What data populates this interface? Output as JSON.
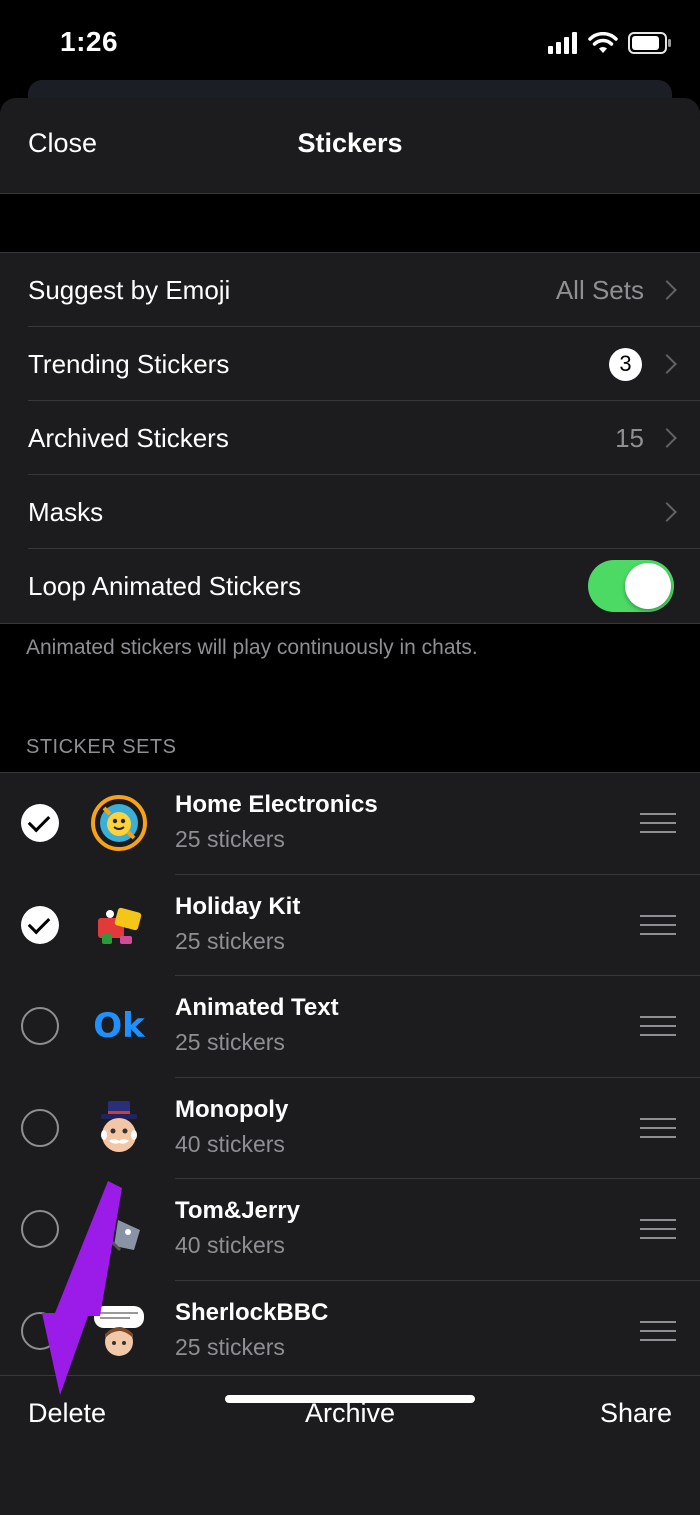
{
  "status_bar": {
    "time": "1:26"
  },
  "navbar": {
    "close_label": "Close",
    "title": "Stickers"
  },
  "settings": {
    "suggest_by_emoji": {
      "label": "Suggest by Emoji",
      "value": "All Sets"
    },
    "trending": {
      "label": "Trending Stickers",
      "badge": "3"
    },
    "archived": {
      "label": "Archived Stickers",
      "value": "15"
    },
    "masks": {
      "label": "Masks"
    },
    "loop": {
      "label": "Loop Animated Stickers",
      "on": true
    },
    "footer": "Animated stickers will play continuously in chats."
  },
  "sticker_sets_header": "STICKER SETS",
  "sticker_sets": [
    {
      "name": "Home Electronics",
      "count": "25 stickers",
      "selected": true
    },
    {
      "name": "Holiday Kit",
      "count": "25 stickers",
      "selected": true
    },
    {
      "name": "Animated Text",
      "count": "25 stickers",
      "selected": false,
      "thumb_text": "Ok"
    },
    {
      "name": "Monopoly",
      "count": "40 stickers",
      "selected": false
    },
    {
      "name": "Tom&Jerry",
      "count": "40 stickers",
      "selected": false
    },
    {
      "name": "SherlockBBC",
      "count": "25 stickers",
      "selected": false
    }
  ],
  "toolbar": {
    "delete_label": "Delete",
    "archive_label": "Archive",
    "share_label": "Share"
  },
  "colors": {
    "toggle_on": "#4cd964",
    "annotation_arrow": "#9b1be8",
    "ok_blue": "#1e90ff"
  }
}
